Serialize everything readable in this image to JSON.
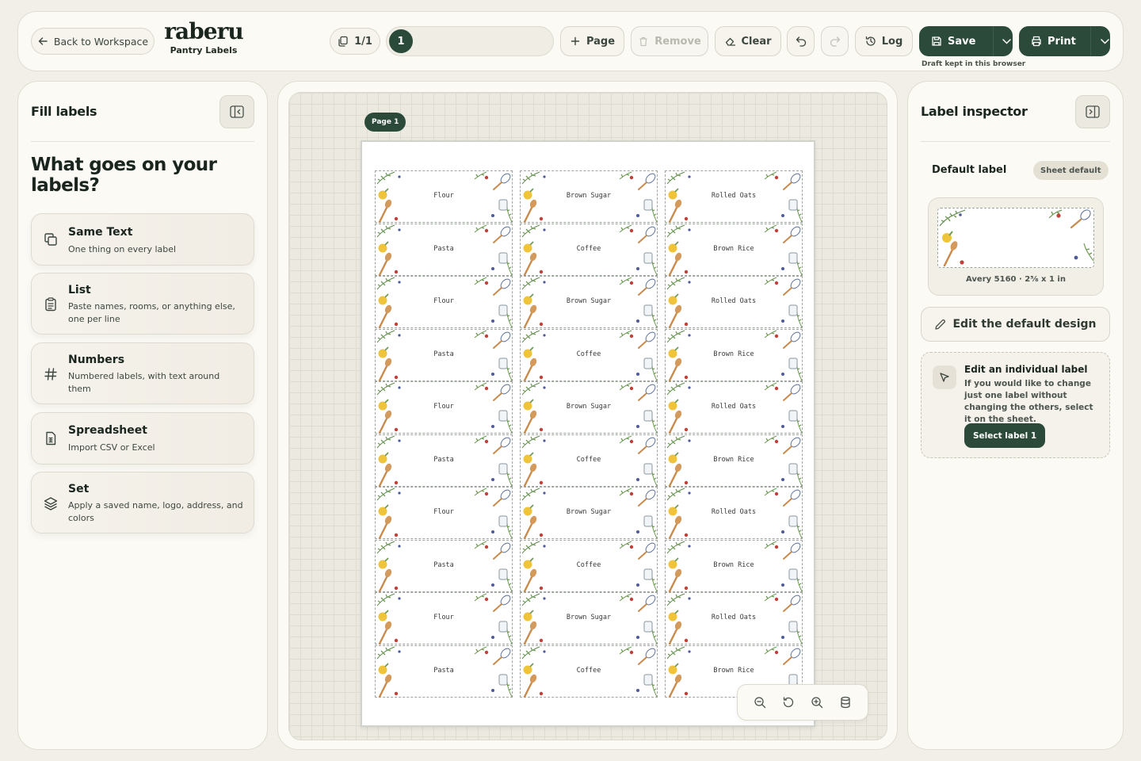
{
  "topbar": {
    "back_label": "Back to Workspace",
    "brand": "raberu",
    "brand_sub": "Pantry Labels",
    "page_count": "1/1",
    "current_page": "1",
    "add_page_label": "Page",
    "remove_label": "Remove",
    "clear_label": "Clear",
    "log_label": "Log",
    "save_label": "Save",
    "print_label": "Print",
    "draft_note": "Draft kept in this browser"
  },
  "left": {
    "title": "Fill labels",
    "headline": "What goes on your labels?",
    "options": [
      {
        "title": "Same Text",
        "desc": "One thing on every label",
        "icon": "copy-icon"
      },
      {
        "title": "List",
        "desc": "Paste names, rooms, or anything else, one per line",
        "icon": "clipboard-list-icon"
      },
      {
        "title": "Numbers",
        "desc": "Numbered labels, with text around them",
        "icon": "hash-icon"
      },
      {
        "title": "Spreadsheet",
        "desc": "Import CSV or Excel",
        "icon": "spreadsheet-icon"
      },
      {
        "title": "Set",
        "desc": "Apply a saved name, logo, address, and colors",
        "icon": "layers-icon"
      }
    ]
  },
  "canvas": {
    "page_tag": "Page 1",
    "labels": [
      [
        "Flour",
        "Brown Sugar",
        "Rolled Oats"
      ],
      [
        "Pasta",
        "Coffee",
        "Brown Rice"
      ],
      [
        "Flour",
        "Brown Sugar",
        "Rolled Oats"
      ],
      [
        "Pasta",
        "Coffee",
        "Brown Rice"
      ],
      [
        "Flour",
        "Brown Sugar",
        "Rolled Oats"
      ],
      [
        "Pasta",
        "Coffee",
        "Brown Rice"
      ],
      [
        "Flour",
        "Brown Sugar",
        "Rolled Oats"
      ],
      [
        "Pasta",
        "Coffee",
        "Brown Rice"
      ],
      [
        "Flour",
        "Brown Sugar",
        "Rolled Oats"
      ],
      [
        "Pasta",
        "Coffee",
        "Brown Rice"
      ]
    ],
    "zoom_tools": [
      "zoom-out-icon",
      "reset-zoom-icon",
      "zoom-in-icon",
      "data-source-icon"
    ]
  },
  "right": {
    "title": "Label inspector",
    "default_label": "Default label",
    "badge": "Sheet default",
    "preview_caption": "Avery 5160 · 2⅝ x 1 in",
    "edit_default": "Edit the default design",
    "indiv_title": "Edit an individual label",
    "indiv_desc": "If you would like to change just one label without changing the others, select it on the sheet.",
    "select_button": "Select label 1"
  },
  "colors": {
    "accent": "#2b4a3a",
    "background": "#f1efe8",
    "panel": "#fbfaf5"
  }
}
